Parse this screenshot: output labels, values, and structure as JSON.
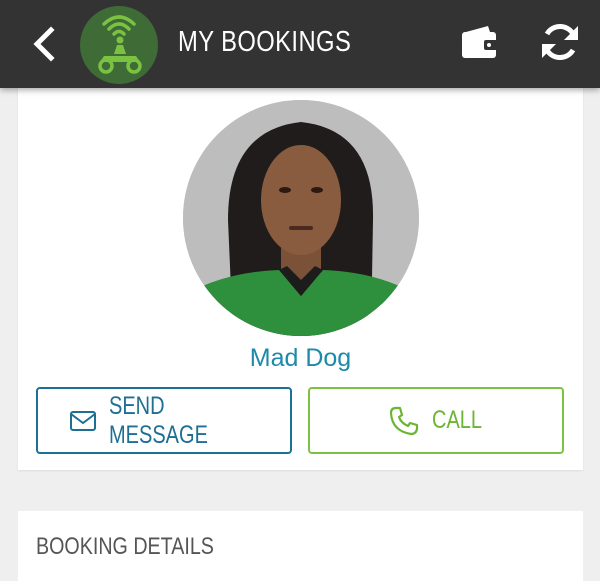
{
  "header": {
    "title": "MY BOOKINGS",
    "icons": [
      "back-arrow-icon",
      "scooter-logo-icon",
      "wallet-icon",
      "refresh-icon"
    ]
  },
  "driver": {
    "name": "Mad Dog",
    "send_message_label": "SEND MESSAGE",
    "call_label": "CALL"
  },
  "booking_details": {
    "title": "BOOKING DETAILS"
  },
  "colors": {
    "topbar": "#333333",
    "brand_green": "#7cc242",
    "message_blue": "#1d6f93",
    "name_teal": "#1d8aa8"
  }
}
